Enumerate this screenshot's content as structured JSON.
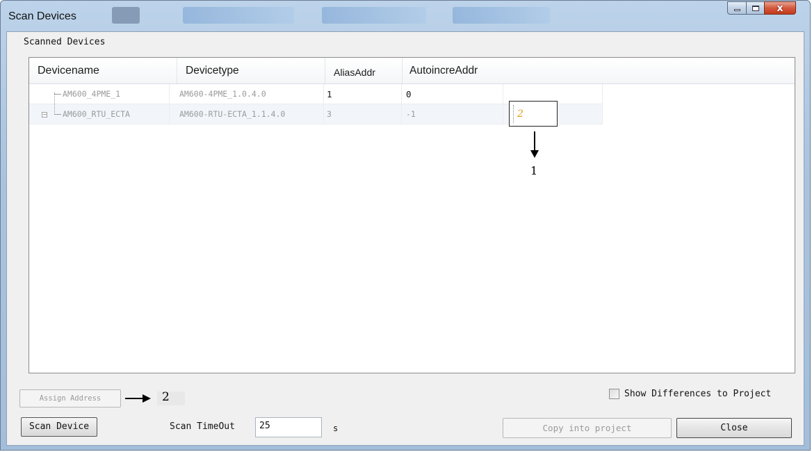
{
  "window": {
    "title": "Scan Devices",
    "controls": {
      "minimize_icon": "minimize-icon",
      "maximize_icon": "maximize-icon",
      "close_glyph": "x"
    }
  },
  "group": {
    "label": "Scanned Devices"
  },
  "grid": {
    "columns": [
      "Devicename",
      "Devicetype",
      "AliasAddr",
      "AutoincreAddr"
    ],
    "rows": [
      {
        "devicename": "AM600_4PME_1",
        "devicetype": "AM600-4PME_1.0.4.0",
        "alias": "1",
        "autoincre": "0"
      },
      {
        "devicename": "AM600_RTU_ECTA",
        "devicetype": "AM600-RTU-ECTA_1.1.4.0",
        "alias": "3",
        "autoincre": "-1"
      }
    ],
    "editor_value": "2",
    "expander_glyph": "−"
  },
  "annotations": {
    "arrow1_label": "1",
    "arrow2_label": "2"
  },
  "buttons": {
    "assign_address": "Assign Address",
    "scan_device": "Scan Device",
    "copy_into_project": "Copy into project",
    "close": "Close"
  },
  "show_differences": {
    "label": "Show Differences to Project",
    "checked": false
  },
  "scan_timeout": {
    "label": "Scan TimeOut",
    "value": "25",
    "unit": "s"
  },
  "colors": {
    "title_gradient": "#a9c3de",
    "close_button": "#c43a1c",
    "editor_value": "#e0a020"
  }
}
